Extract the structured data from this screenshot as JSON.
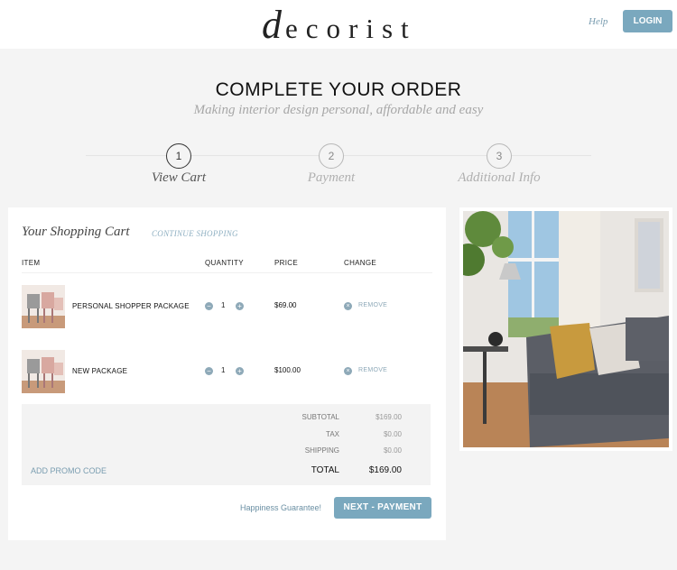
{
  "header": {
    "logo_initial": "d",
    "logo_rest": "ecorist",
    "help": "Help",
    "login": "LOGIN"
  },
  "page": {
    "title": "COMPLETE YOUR ORDER",
    "subtitle": "Making interior design personal, affordable and easy"
  },
  "steps": [
    {
      "number": "1",
      "label": "View Cart",
      "active": true
    },
    {
      "number": "2",
      "label": "Payment",
      "active": false
    },
    {
      "number": "3",
      "label": "Additional Info",
      "active": false
    }
  ],
  "cart": {
    "title": "Your Shopping Cart",
    "continue": "CONTINUE SHOPPING",
    "columns": {
      "item": "ITEM",
      "quantity": "QUANTITY",
      "price": "PRICE",
      "change": "CHANGE"
    },
    "items": [
      {
        "name": "PERSONAL SHOPPER PACKAGE",
        "qty": "1",
        "price": "$69.00",
        "remove": "REMOVE"
      },
      {
        "name": "NEW PACKAGE",
        "qty": "1",
        "price": "$100.00",
        "remove": "REMOVE"
      }
    ],
    "summary": {
      "subtotal_label": "SUBTOTAL",
      "subtotal": "$169.00",
      "tax_label": "TAX",
      "tax": "$0.00",
      "shipping_label": "SHIPPING",
      "shipping": "$0.00",
      "total_label": "TOTAL",
      "total": "$169.00",
      "promo": "ADD PROMO CODE"
    },
    "happiness": "Happiness Guarantee!",
    "next": "NEXT - PAYMENT"
  },
  "icons": {
    "minus": "minus-icon",
    "plus": "plus-icon",
    "remove": "remove-icon"
  },
  "colors": {
    "accent": "#7aa8be",
    "link": "#7a9db0",
    "background": "#f4f4f4"
  }
}
